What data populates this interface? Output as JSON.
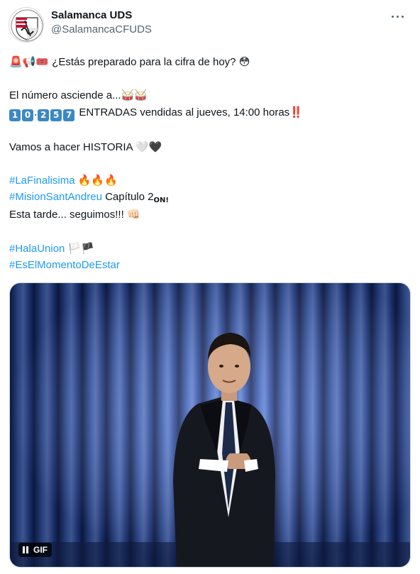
{
  "author": {
    "display_name": "Salamanca UDS",
    "handle": "@SalamancaCFUDS",
    "avatar_icon": "club-crest-icon"
  },
  "tweet": {
    "line1_emoji": "🚨📢🎟️",
    "line1_text": "¿Estás preparado para la cifra de hoy?",
    "line1_end_emoji": "😳",
    "line2_text": "El número asciende a...",
    "line2_emoji": "🥁🥁",
    "count_digits": [
      "1",
      "0",
      "2",
      "5",
      "7"
    ],
    "count_separator": ".",
    "count_text": "ENTRADAS vendidas al jueves, 14:00 horas",
    "count_end_emoji": "‼️",
    "line4_text": "Vamos a hacer HISTORIA",
    "line4_heart_white": "🤍",
    "line4_heart_black": "🖤",
    "hashtag1": "#LaFinalisima",
    "hashtag1_emoji": "🔥🔥🔥",
    "hashtag2": "#MisionSantAndreu",
    "hashtag2_suffix": "Capítulo 2",
    "hashtag2_emoji": "ON!",
    "line7_text": "Esta tarde... seguimos!!!",
    "line7_emoji": "👊🏻",
    "hashtag3": "#HalaUnion",
    "hashtag3_emoji": "🏳️🏴",
    "hashtag4": "#EsElMomentoDeEstar"
  },
  "media": {
    "badge_label": "GIF",
    "pause_icon": "pause-icon"
  },
  "colors": {
    "hashtag": "#1d9bf0",
    "keycap": "#3b88c3",
    "curtain": "#2d4fa0"
  }
}
